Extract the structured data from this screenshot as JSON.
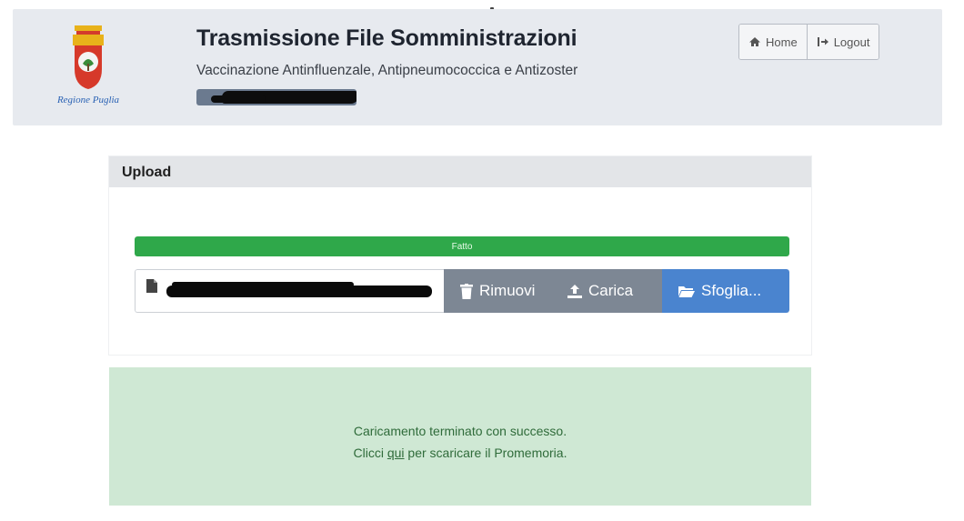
{
  "header": {
    "logo_caption": "Regione Puglia",
    "title": "Trasmissione File Somministrazioni",
    "subtitle": "Vaccinazione Antinfluenzale, Antipneumococcica e Antizoster",
    "nav": {
      "home_label": "Home",
      "logout_label": "Logout"
    }
  },
  "upload": {
    "title": "Upload",
    "progress": {
      "label": "Fatto",
      "percent": 100,
      "color": "#2fa84a"
    },
    "actions": {
      "remove_label": "Rimuovi",
      "upload_label": "Carica",
      "browse_label": "Sfoglia..."
    }
  },
  "alert": {
    "message": "Caricamento terminato con successo.",
    "download_prefix": "Clicci",
    "download_link": "qui",
    "download_suffix": "per scaricare il Promemoria."
  },
  "colors": {
    "success": "#2fa84a",
    "primary": "#4a84cf",
    "secondary": "#7d8794",
    "alert_bg": "#cfe8d4",
    "alert_text": "#2f6b3a"
  },
  "icons": {
    "home": "home-icon",
    "logout": "logout-icon",
    "file": "file-icon",
    "remove": "trash-icon",
    "upload": "upload-icon",
    "browse": "folder-open-icon"
  }
}
